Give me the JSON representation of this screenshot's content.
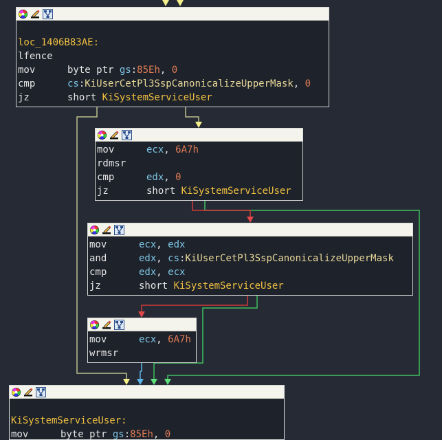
{
  "colors": {
    "background": "#262a35",
    "node_bg": "#1e222b",
    "header_bg": "#f4f4ec",
    "edge_unconditional": "#bcc08c",
    "edge_true": "#3fbf5f",
    "edge_false": "#d23a3a",
    "edge_fallthrough": "#5ab4e6",
    "arrow_yellow": "#f4f08a"
  },
  "header_icons": [
    "color-wheel-icon",
    "edit-pen-icon",
    "graph-view-icon"
  ],
  "nodes": [
    {
      "id": "node1",
      "label": "loc_1406B83AE:",
      "lines": [
        {
          "kind": "plain",
          "text": "lfence"
        },
        {
          "kind": "insn",
          "mn": "mov",
          "ops": [
            [
              "nm",
              "byte ptr "
            ],
            [
              "seg",
              "gs"
            ],
            [
              "nm",
              ":"
            ],
            [
              "num",
              "85Eh"
            ],
            [
              "nm",
              ", "
            ],
            [
              "num",
              "0"
            ]
          ]
        },
        {
          "kind": "insn",
          "mn": "cmp",
          "ops": [
            [
              "seg",
              "cs"
            ],
            [
              "nm",
              ":"
            ],
            [
              "sym",
              "KiUserCetPl3SspCanonicalizeUpperMask"
            ],
            [
              "nm",
              ", "
            ],
            [
              "num",
              "0"
            ]
          ]
        },
        {
          "kind": "insn",
          "mn": "jz",
          "ops": [
            [
              "nm",
              "short "
            ],
            [
              "lbl",
              "KiSystemServiceUser"
            ]
          ]
        }
      ]
    },
    {
      "id": "node2",
      "lines": [
        {
          "kind": "insn",
          "mn": "mov",
          "ops": [
            [
              "reg",
              "ecx"
            ],
            [
              "nm",
              ", "
            ],
            [
              "num",
              "6A7h"
            ]
          ]
        },
        {
          "kind": "plain",
          "text": "rdmsr"
        },
        {
          "kind": "insn",
          "mn": "cmp",
          "ops": [
            [
              "reg",
              "edx"
            ],
            [
              "nm",
              ", "
            ],
            [
              "num",
              "0"
            ]
          ]
        },
        {
          "kind": "insn",
          "mn": "jz",
          "ops": [
            [
              "nm",
              "short "
            ],
            [
              "lbl",
              "KiSystemServiceUser"
            ]
          ]
        }
      ]
    },
    {
      "id": "node3",
      "lines": [
        {
          "kind": "insn",
          "mn": "mov",
          "ops": [
            [
              "reg",
              "ecx"
            ],
            [
              "nm",
              ", "
            ],
            [
              "reg",
              "edx"
            ]
          ]
        },
        {
          "kind": "insn",
          "mn": "and",
          "ops": [
            [
              "reg",
              "edx"
            ],
            [
              "nm",
              ", "
            ],
            [
              "seg",
              "cs"
            ],
            [
              "nm",
              ":"
            ],
            [
              "sym",
              "KiUserCetPl3SspCanonicalizeUpperMask"
            ]
          ]
        },
        {
          "kind": "insn",
          "mn": "cmp",
          "ops": [
            [
              "reg",
              "edx"
            ],
            [
              "nm",
              ", "
            ],
            [
              "reg",
              "ecx"
            ]
          ]
        },
        {
          "kind": "insn",
          "mn": "jz",
          "ops": [
            [
              "nm",
              "short "
            ],
            [
              "lbl",
              "KiSystemServiceUser"
            ]
          ]
        }
      ]
    },
    {
      "id": "node4",
      "lines": [
        {
          "kind": "insn",
          "mn": "mov",
          "ops": [
            [
              "reg",
              "ecx"
            ],
            [
              "nm",
              ", "
            ],
            [
              "num",
              "6A7h"
            ]
          ]
        },
        {
          "kind": "plain",
          "text": "wrmsr"
        }
      ]
    },
    {
      "id": "node5",
      "label": "KiSystemServiceUser:",
      "lines": [
        {
          "kind": "insn",
          "mn": "mov",
          "ops": [
            [
              "nm",
              "byte ptr "
            ],
            [
              "seg",
              "gs"
            ],
            [
              "nm",
              ":"
            ],
            [
              "num",
              "85Eh"
            ],
            [
              "nm",
              ", "
            ],
            [
              "num",
              "0"
            ]
          ]
        }
      ]
    }
  ]
}
